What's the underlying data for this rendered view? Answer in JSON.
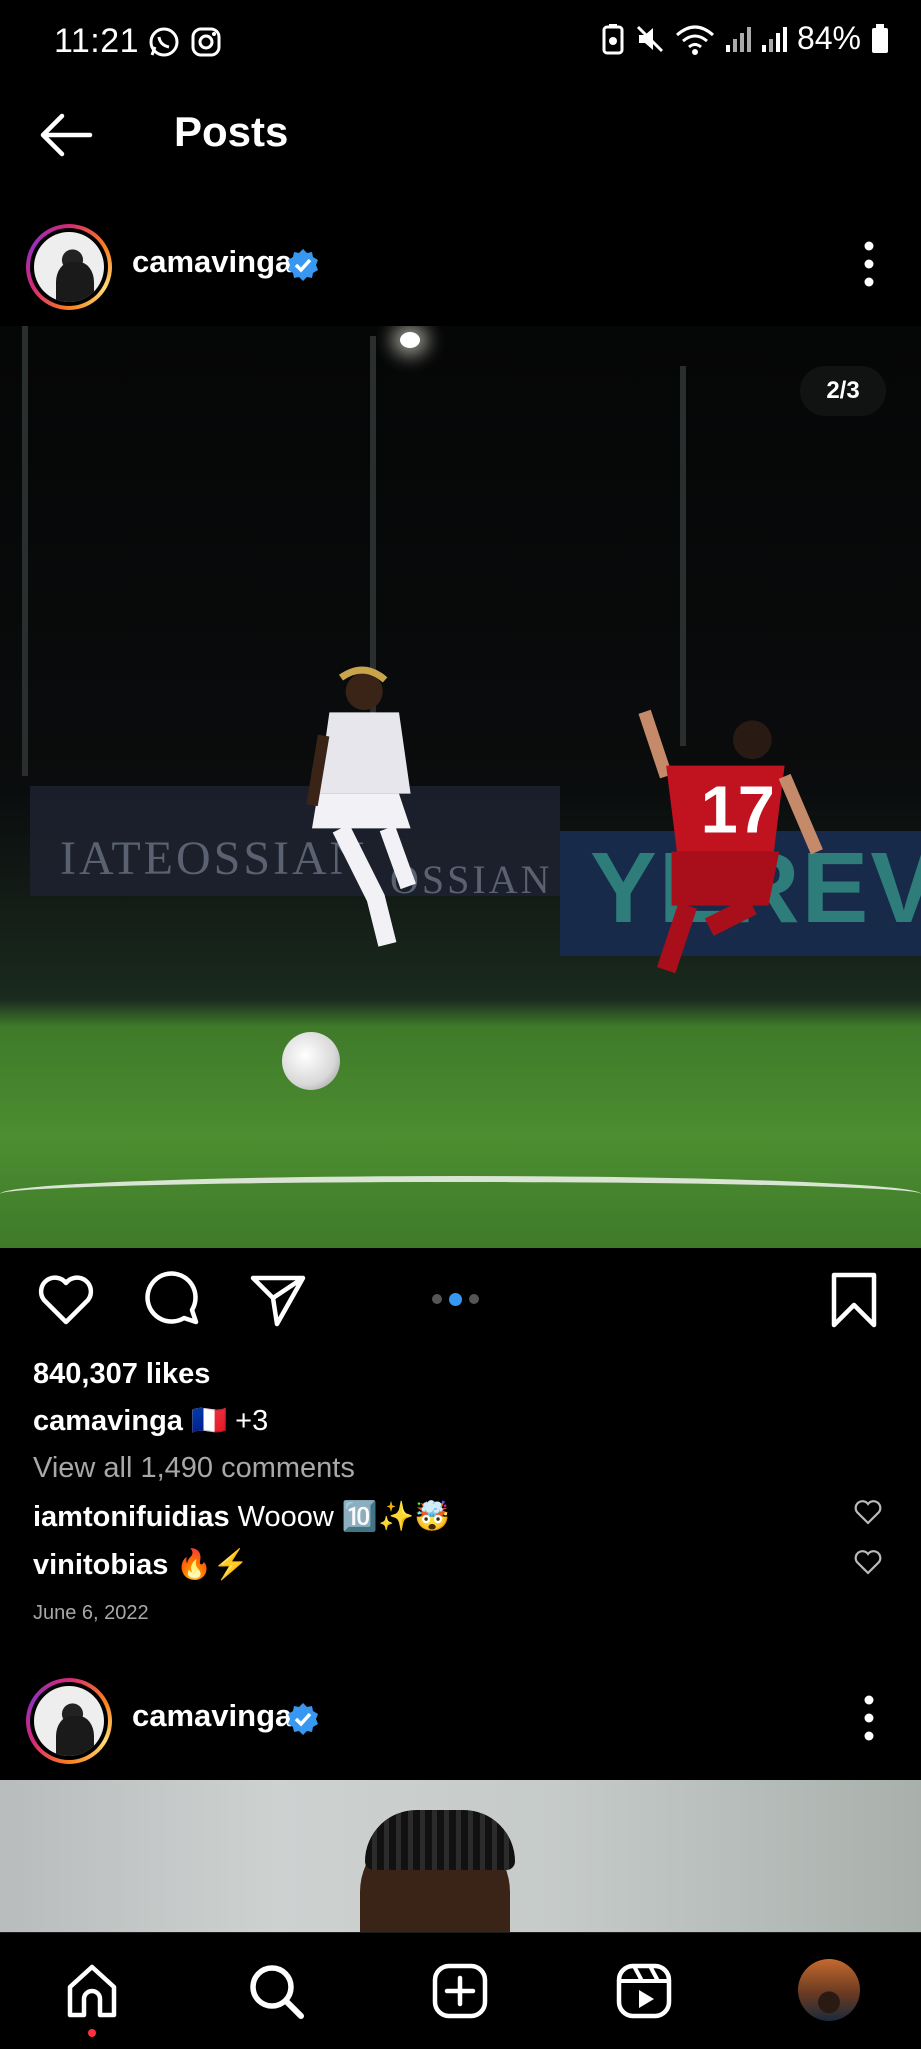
{
  "status_bar": {
    "time": "11:21",
    "battery": "84%",
    "icons": [
      "whatsapp-icon",
      "instagram-icon",
      "battery-saver-icon",
      "mute-icon",
      "wifi-icon",
      "signal-icon",
      "signal-icon",
      "battery-icon"
    ]
  },
  "header": {
    "title": "Posts"
  },
  "post": {
    "username": "camavinga",
    "verified": true,
    "carousel_counter": "2/3",
    "carousel_total": 3,
    "carousel_index": 2,
    "likes": "840,307 likes",
    "caption_user": "camavinga",
    "caption_text": "🇫🇷 +3",
    "view_all_comments": "View all 1,490 comments",
    "comments": [
      {
        "user": "iamtonifuidias",
        "text": "Wooow 🔟✨🤯"
      },
      {
        "user": "vinitobias",
        "text": "🔥⚡"
      }
    ],
    "date": "June 6, 2022",
    "photo_banners": [
      "IATEOSSIAN",
      "OSSIAN",
      "YEREVAN"
    ],
    "jersey_number": "17"
  },
  "next_post": {
    "username": "camavinga",
    "verified": true
  },
  "colors": {
    "background": "#000000",
    "accent": "#3897f0",
    "secondary_text": "#a8a8a8",
    "notification": "#ff3040"
  },
  "nav": [
    "home-icon",
    "search-icon",
    "create-icon",
    "reels-icon",
    "profile-avatar"
  ]
}
